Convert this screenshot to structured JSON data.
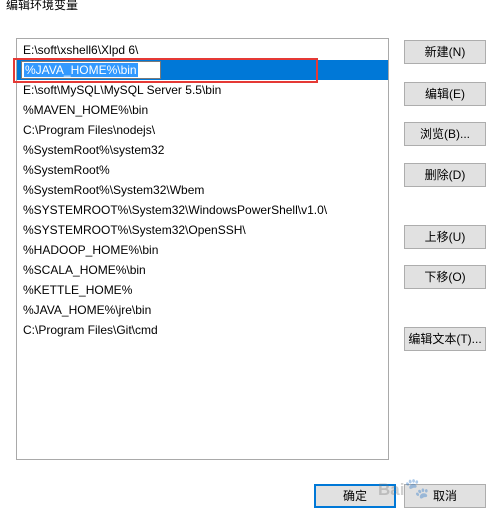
{
  "window": {
    "title": "编辑环境变量"
  },
  "list": {
    "items": [
      "E:\\soft\\xshell6\\Xlpd 6\\",
      "%JAVA_HOME%\\bin",
      "E:\\soft\\MySQL\\MySQL Server 5.5\\bin",
      "%MAVEN_HOME%\\bin",
      "C:\\Program Files\\nodejs\\",
      "%SystemRoot%\\system32",
      "%SystemRoot%",
      "%SystemRoot%\\System32\\Wbem",
      "%SYSTEMROOT%\\System32\\WindowsPowerShell\\v1.0\\",
      "%SYSTEMROOT%\\System32\\OpenSSH\\",
      "%HADOOP_HOME%\\bin",
      "%SCALA_HOME%\\bin",
      "%KETTLE_HOME%",
      "%JAVA_HOME%\\jre\\bin",
      "C:\\Program Files\\Git\\cmd"
    ],
    "selected_index": 1,
    "editing_value": "%JAVA_HOME%\\bin"
  },
  "buttons": {
    "new": "新建(N)",
    "edit": "编辑(E)",
    "browse": "浏览(B)...",
    "delete": "删除(D)",
    "move_up": "上移(U)",
    "move_down": "下移(O)",
    "edit_text": "编辑文本(T)...",
    "ok": "确定",
    "cancel": "取消"
  },
  "watermark": {
    "text": "Bai",
    "paw": "🐾"
  },
  "colors": {
    "selection": "#0078d7",
    "highlight_box": "#e53935",
    "button_face": "#e1e1e1"
  }
}
